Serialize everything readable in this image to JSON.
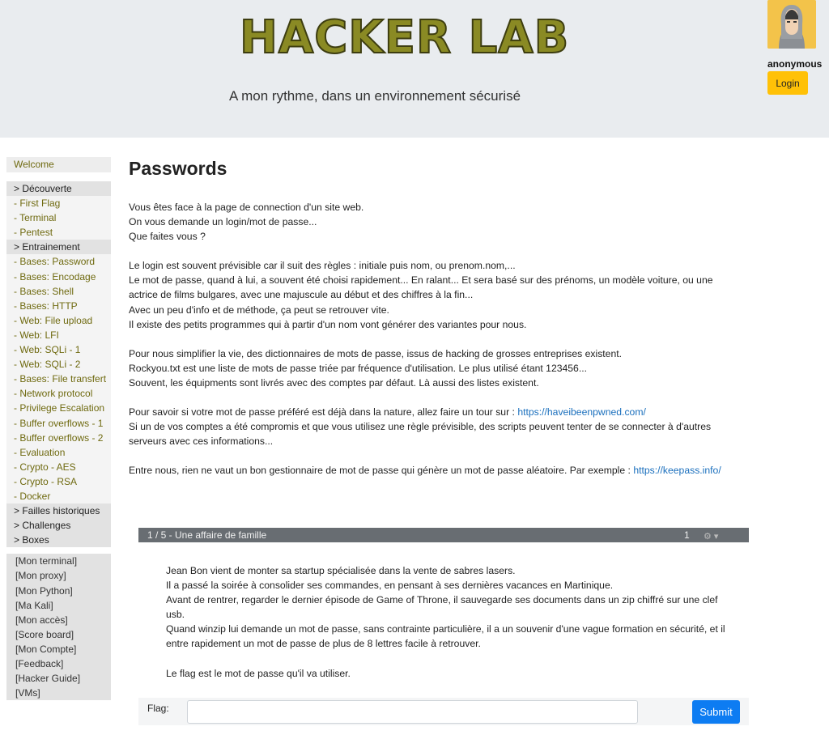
{
  "header": {
    "logo": "HACKER LAB",
    "tagline": "A mon rythme, dans un environnement sécurisé",
    "username": "anonymous",
    "login_label": "Login",
    "avatar_icon": "hacker-avatar-icon",
    "colors": {
      "background": "#e9ecef",
      "logo": "#8a8a24",
      "login_button": "#ffc107"
    }
  },
  "sidebar": {
    "welcome": "Welcome",
    "items": [
      {
        "label": "> Découverte",
        "section": true
      },
      {
        "label": "- First Flag",
        "section": false
      },
      {
        "label": "- Terminal",
        "section": false
      },
      {
        "label": "- Pentest",
        "section": false
      },
      {
        "label": "> Entrainement",
        "section": true
      },
      {
        "label": "- Bases: Password",
        "section": false
      },
      {
        "label": "- Bases: Encodage",
        "section": false
      },
      {
        "label": "- Bases: Shell",
        "section": false
      },
      {
        "label": "- Bases: HTTP",
        "section": false
      },
      {
        "label": "- Web: File upload",
        "section": false
      },
      {
        "label": "- Web: LFI",
        "section": false
      },
      {
        "label": "- Web: SQLi - 1",
        "section": false
      },
      {
        "label": "- Web: SQLi - 2",
        "section": false
      },
      {
        "label": "- Bases: File transfert",
        "section": false
      },
      {
        "label": "- Network protocol",
        "section": false
      },
      {
        "label": "- Privilege Escalation",
        "section": false
      },
      {
        "label": "- Buffer overflows - 1",
        "section": false
      },
      {
        "label": "- Buffer overflows - 2",
        "section": false
      },
      {
        "label": "- Evaluation",
        "section": false
      },
      {
        "label": "- Crypto - AES",
        "section": false
      },
      {
        "label": "- Crypto - RSA",
        "section": false
      },
      {
        "label": "- Docker",
        "section": false
      },
      {
        "label": "> Failles historiques",
        "section": true
      },
      {
        "label": "> Challenges",
        "section": true
      },
      {
        "label": "> Boxes",
        "section": true
      }
    ],
    "tools": [
      "[Mon terminal]",
      "[Mon proxy]",
      "[Mon Python]",
      "[Ma Kali]",
      "[Mon accès]",
      "[Score board]",
      "[Mon Compte]",
      "[Feedback]",
      "[Hacker Guide]",
      "[VMs]"
    ]
  },
  "main": {
    "title": "Passwords",
    "p1": [
      "Vous êtes face à la page de connection d'un site web.",
      "On vous demande un login/mot de passe...",
      "Que faites vous ?"
    ],
    "p2": [
      "Le login est souvent prévisible car il suit des règles : initiale puis nom, ou prenom.nom,...",
      "Le mot de passe, quand à lui, a souvent été choisi rapidement... En ralant... Et sera basé sur des prénoms, un modèle voiture, ou une",
      "actrice de films bulgares, avec une majuscule au début et des chiffres à la fin...",
      "Avec un peu d'info et de méthode, ça peut se retrouver vite.",
      "Il existe des petits programmes qui à partir d'un nom vont générer des variantes pour nous."
    ],
    "p3": [
      "Pour nous simplifier la vie, des dictionnaires de mots de passe, issus de hacking de grosses entreprises existent.",
      "Rockyou.txt est une liste de mots de passe triée par fréquence d'utilisation. Le plus utilisé étant 123456...",
      "Souvent, les équipments sont livrés avec des comptes par défaut. Là aussi des listes existent."
    ],
    "p4_intro": "Pour savoir si votre mot de passe préféré est déjà dans la nature, allez faire un tour sur : ",
    "p4_link": "https://haveibeenpwned.com/",
    "p4_rest": [
      "Si un de vos comptes a été compromis et que vous utilisez une règle prévisible, des scripts peuvent tenter de se connecter à d'autres",
      "serveurs avec ces informations..."
    ],
    "p5_intro": "Entre nous, rien ne vaut un bon gestionnaire de mot de passe qui génère un mot de passe aléatoire. Par exemple : ",
    "p5_link": "https://keepass.info/"
  },
  "challenge": {
    "title": "1 / 5 - Une affaire de famille",
    "count": "1",
    "gear_icon": "gear-icon",
    "text": [
      "Jean Bon vient de monter sa startup spécialisée dans la vente de sabres lasers.",
      "Il a passé la soirée à consolider ses commandes, en pensant à ses dernières vacances en Martinique.",
      "Avant de rentrer, regarder le dernier épisode de Game of Throne, il sauvegarde ses documents dans un zip chiffré sur une clef",
      "usb.",
      "Quand winzip lui demande un mot de passe, sans contrainte particulière, il a un souvenir d'une vague formation en sécurité, et il",
      "entre rapidement un mot de passe de plus de 8 lettres facile à retrouver."
    ],
    "text_end": "Le flag est le mot de passe qu'il va utiliser.",
    "flag_label": "Flag:",
    "flag_value": "",
    "submit_label": "Submit"
  }
}
